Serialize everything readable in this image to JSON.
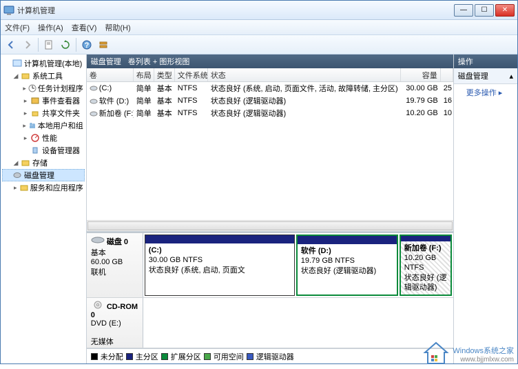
{
  "window": {
    "title": "计算机管理"
  },
  "menu": {
    "file": "文件(F)",
    "action": "操作(A)",
    "view": "查看(V)",
    "help": "帮助(H)"
  },
  "tree": {
    "root": "计算机管理(本地)",
    "system_tools": "系统工具",
    "task_scheduler": "任务计划程序",
    "event_viewer": "事件查看器",
    "shared_folders": "共享文件夹",
    "local_users": "本地用户和组",
    "performance": "性能",
    "device_manager": "设备管理器",
    "storage": "存储",
    "disk_management": "磁盘管理",
    "services_apps": "服务和应用程序"
  },
  "center_header": {
    "label": "磁盘管理",
    "sublabel": "卷列表 + 图形视图"
  },
  "vol_columns": {
    "volume": "卷",
    "layout": "布局",
    "type": "类型",
    "filesystem": "文件系统",
    "status": "状态",
    "capacity": "容量"
  },
  "volumes": [
    {
      "name": "(C:)",
      "layout": "简单",
      "type": "基本",
      "fs": "NTFS",
      "status": "状态良好 (系统, 启动, 页面文件, 活动, 故障转储, 主分区)",
      "capacity": "30.00 GB",
      "free": "25"
    },
    {
      "name": "软件 (D:)",
      "layout": "简单",
      "type": "基本",
      "fs": "NTFS",
      "status": "状态良好 (逻辑驱动器)",
      "capacity": "19.79 GB",
      "free": "16"
    },
    {
      "name": "新加卷 (F:)",
      "layout": "简单",
      "type": "基本",
      "fs": "NTFS",
      "status": "状态良好 (逻辑驱动器)",
      "capacity": "10.20 GB",
      "free": "10"
    }
  ],
  "disks": [
    {
      "label": "磁盘 0",
      "type": "基本",
      "size": "60.00 GB",
      "status": "联机",
      "partitions": [
        {
          "name": "(C:)",
          "size": "30.00 GB NTFS",
          "status": "状态良好 (系统, 启动, 页面文"
        },
        {
          "name": "软件 (D:)",
          "size": "19.79 GB NTFS",
          "status": "状态良好 (逻辑驱动器)"
        },
        {
          "name": "新加卷 (F:)",
          "size": "10.20 GB NTFS",
          "status": "状态良好 (逻辑驱动器)"
        }
      ]
    },
    {
      "label": "CD-ROM 0",
      "type": "DVD (E:)",
      "size": "",
      "status": "无媒体"
    }
  ],
  "legend": {
    "unallocated": "未分配",
    "primary": "主分区",
    "extended": "扩展分区",
    "free": "可用空间",
    "logical": "逻辑驱动器"
  },
  "actions": {
    "header": "操作",
    "section": "磁盘管理",
    "more": "更多操作"
  },
  "watermark": {
    "line1": "Windows系统之家",
    "line2": "www.bjjmlxw.com"
  }
}
